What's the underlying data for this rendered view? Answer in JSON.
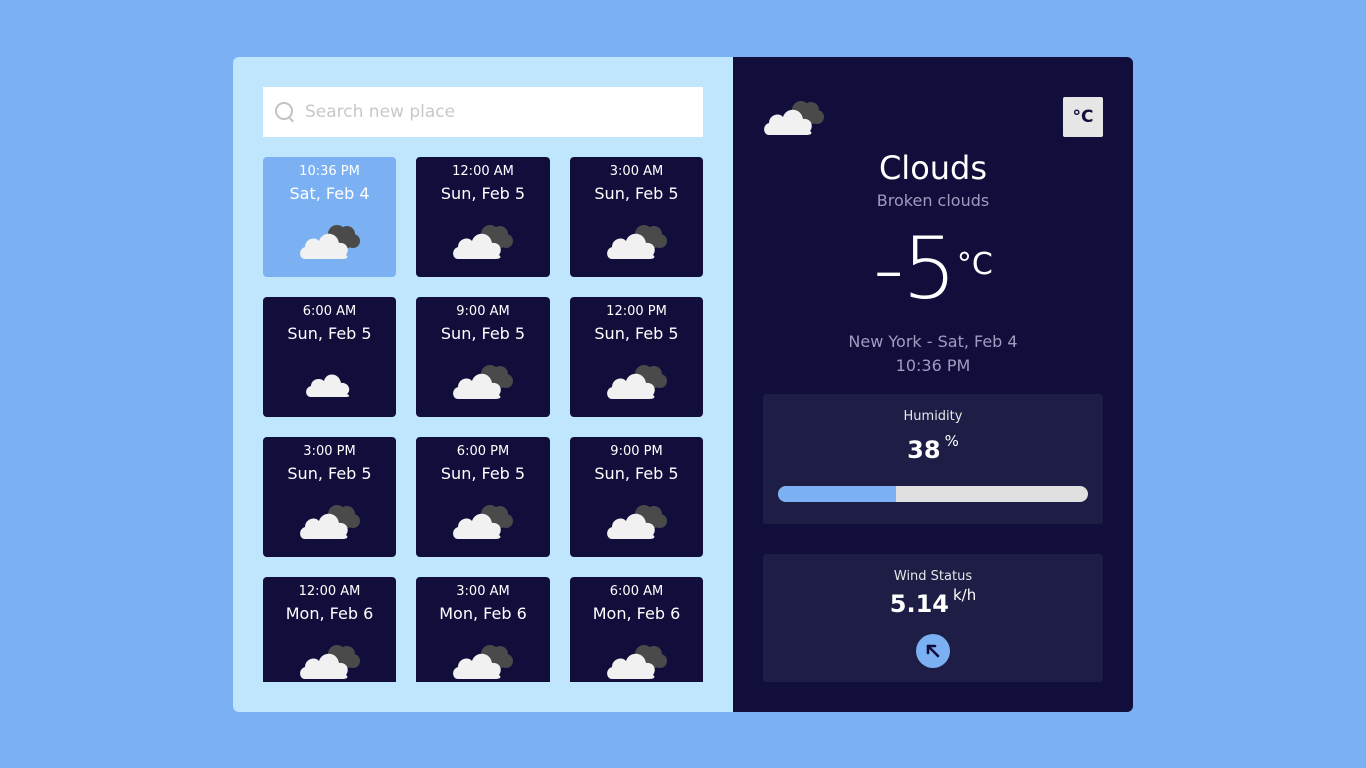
{
  "search": {
    "placeholder": "Search new place"
  },
  "forecast": [
    {
      "time": "10:36 PM",
      "date": "Sat, Feb 4",
      "icon": "broken-clouds-icon",
      "active": true
    },
    {
      "time": "12:00 AM",
      "date": "Sun, Feb 5",
      "icon": "broken-clouds-icon"
    },
    {
      "time": "3:00 AM",
      "date": "Sun, Feb 5",
      "icon": "broken-clouds-icon"
    },
    {
      "time": "6:00 AM",
      "date": "Sun, Feb 5",
      "icon": "cloud-icon"
    },
    {
      "time": "9:00 AM",
      "date": "Sun, Feb 5",
      "icon": "broken-clouds-icon"
    },
    {
      "time": "12:00 PM",
      "date": "Sun, Feb 5",
      "icon": "broken-clouds-icon"
    },
    {
      "time": "3:00 PM",
      "date": "Sun, Feb 5",
      "icon": "broken-clouds-icon"
    },
    {
      "time": "6:00 PM",
      "date": "Sun, Feb 5",
      "icon": "broken-clouds-icon"
    },
    {
      "time": "9:00 PM",
      "date": "Sun, Feb 5",
      "icon": "broken-clouds-icon"
    },
    {
      "time": "12:00 AM",
      "date": "Mon, Feb 6",
      "icon": "broken-clouds-icon"
    },
    {
      "time": "3:00 AM",
      "date": "Mon, Feb 6",
      "icon": "broken-clouds-icon"
    },
    {
      "time": "6:00 AM",
      "date": "Mon, Feb 6",
      "icon": "broken-clouds-icon"
    }
  ],
  "current": {
    "icon": "broken-clouds-icon",
    "unit_toggle": "°C",
    "condition": "Clouds",
    "description": "Broken clouds",
    "temperature": "-5",
    "temperature_unit": "°C",
    "location_date": "New York - Sat, Feb 4",
    "time": "10:36 PM"
  },
  "humidity": {
    "label": "Humidity",
    "value": "38",
    "unit": "%",
    "percent": 38
  },
  "wind": {
    "label": "Wind Status",
    "value": "5.14",
    "unit": "k/h",
    "direction_icon": "arrow-up-left-icon"
  },
  "colors": {
    "background": "#7bb0f2",
    "left_panel": "#bfe6fc",
    "right_panel": "#110e3c",
    "card": "#110e3c",
    "card_active": "#7bb0f2",
    "stat_panel": "#1e1d46",
    "accent": "#7bb0f2"
  }
}
